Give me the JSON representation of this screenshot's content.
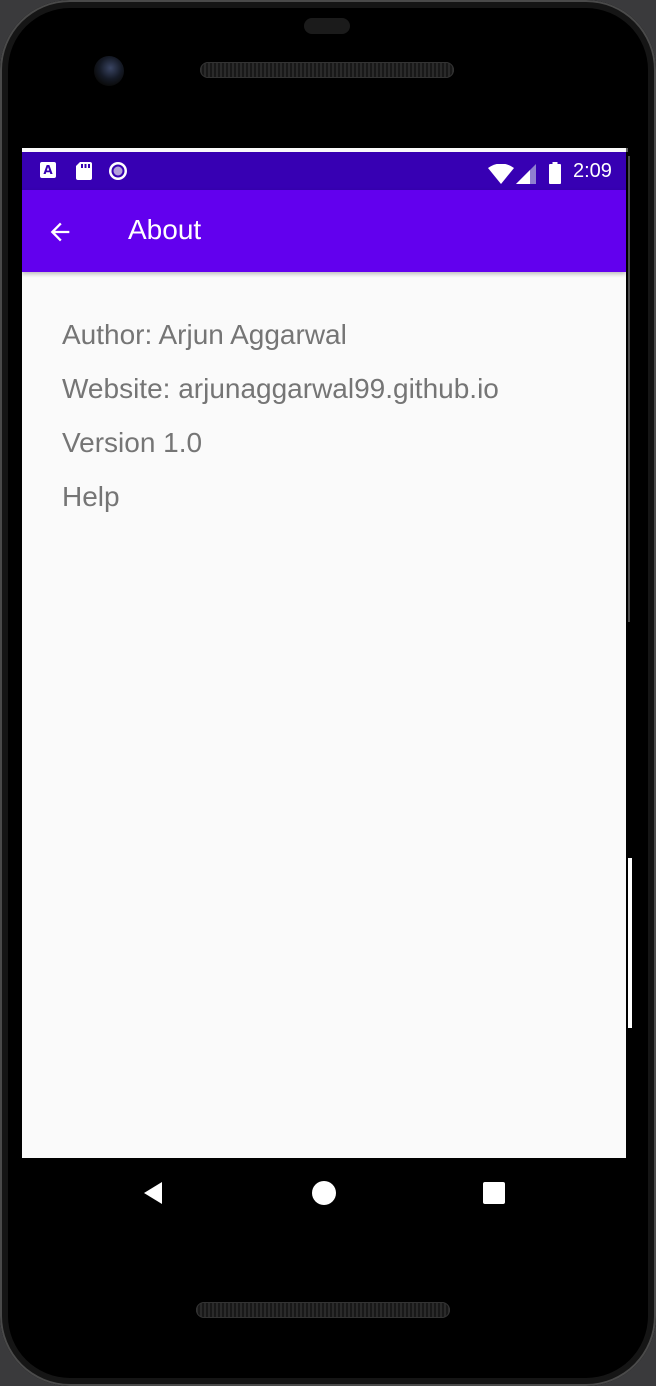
{
  "status_bar": {
    "time": "2:09",
    "left_icons": [
      "a-notification-icon",
      "sd-card-icon",
      "record-circle-icon"
    ],
    "right_icons": [
      "wifi-icon",
      "signal-icon",
      "battery-icon"
    ],
    "a_icon_letter": "A",
    "background_color": "#3700b3"
  },
  "app_bar": {
    "title": "About",
    "back_icon": "arrow-back-icon",
    "background_color": "#6200ee"
  },
  "about": {
    "author": "Author: Arjun Aggarwal",
    "website": "Website: arjunaggarwal99.github.io",
    "version": "Version 1.0",
    "help": "Help"
  },
  "nav_bar": {
    "icons": [
      "nav-back-icon",
      "nav-home-icon",
      "nav-recents-icon"
    ]
  },
  "colors": {
    "screen_background": "#fafafa",
    "body_text": "#757575"
  }
}
